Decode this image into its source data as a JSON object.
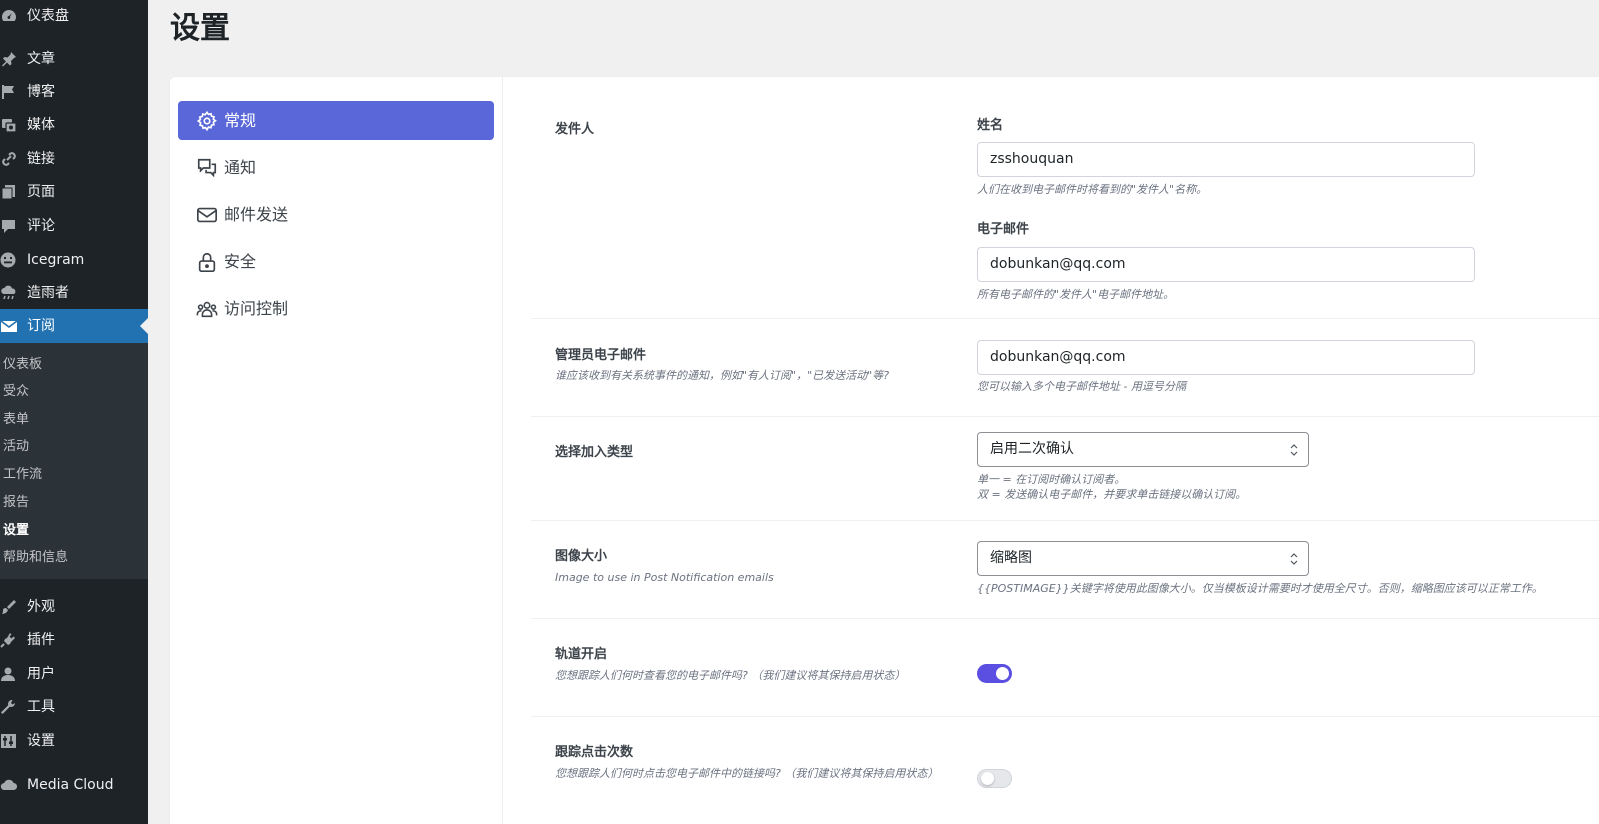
{
  "admin_menu": {
    "items": [
      {
        "label": "仪表盘",
        "icon": "dashboard-icon"
      },
      {
        "label": "文章",
        "icon": "pin-icon"
      },
      {
        "label": "博客",
        "icon": "flag-icon"
      },
      {
        "label": "媒体",
        "icon": "media-icon"
      },
      {
        "label": "链接",
        "icon": "link-icon"
      },
      {
        "label": "页面",
        "icon": "pages-icon"
      },
      {
        "label": "评论",
        "icon": "comment-icon"
      },
      {
        "label": "Icegram",
        "icon": "icegram-icon"
      },
      {
        "label": "造雨者",
        "icon": "cloud-rain-icon"
      },
      {
        "label": "订阅",
        "icon": "email-icon"
      },
      {
        "label": "外观",
        "icon": "brush-icon"
      },
      {
        "label": "插件",
        "icon": "plugin-icon"
      },
      {
        "label": "用户",
        "icon": "user-icon"
      },
      {
        "label": "工具",
        "icon": "wrench-icon"
      },
      {
        "label": "设置",
        "icon": "settings-icon"
      },
      {
        "label": "Media Cloud",
        "icon": "cloud-icon"
      }
    ],
    "submenu": [
      "仪表板",
      "受众",
      "表单",
      "活动",
      "工作流",
      "报告",
      "设置",
      "帮助和信息"
    ]
  },
  "page": {
    "title": "设置"
  },
  "tabs": [
    {
      "label": "常规",
      "icon": "gear-icon"
    },
    {
      "label": "通知",
      "icon": "chat-bubbles-icon"
    },
    {
      "label": "邮件发送",
      "icon": "envelope-icon"
    },
    {
      "label": "安全",
      "icon": "lock-icon"
    },
    {
      "label": "访问控制",
      "icon": "users-icon"
    }
  ],
  "settings": {
    "sender": {
      "title": "发件人",
      "name_label": "姓名",
      "name_value": "zsshouquan",
      "name_help": "人们在收到电子邮件时将看到的\"发件人\"名称。",
      "email_label": "电子邮件",
      "email_value": "dobunkan@qq.com",
      "email_help": "所有电子邮件的\"发件人\"电子邮件地址。"
    },
    "admin_email": {
      "title": "管理员电子邮件",
      "desc": "谁应该收到有关系统事件的通知，例如\"有人订阅\"，\"已发送活动\"等?",
      "value": "dobunkan@qq.com",
      "help": "您可以输入多个电子邮件地址 - 用逗号分隔"
    },
    "optin_type": {
      "title": "选择加入类型",
      "selected": "启用二次确认",
      "help_line1": "单一 = 在订阅时确认订阅者。",
      "help_line2": "双 = 发送确认电子邮件，并要求单击链接以确认订阅。"
    },
    "image_size": {
      "title": "图像大小",
      "desc": "Image to use in Post Notification emails",
      "selected": "缩略图",
      "help": "{{POSTIMAGE}}关键字将使用此图像大小。仅当模板设计需要时才使用全尺寸。否则，缩略图应该可以正常工作。"
    },
    "track_opens": {
      "title": "轨道开启",
      "desc": "您想跟踪人们何时查看您的电子邮件吗? （我们建议将其保持启用状态）",
      "enabled": true
    },
    "track_clicks": {
      "title": "跟踪点击次数",
      "desc": "您想跟踪人们何时点击您电子邮件中的链接吗? （我们建议将其保持启用状态）",
      "enabled": false
    }
  },
  "colors": {
    "accent": "#5a67d8",
    "toggle_on": "#5a4fe0",
    "menu_bg": "#1d2327",
    "menu_current": "#2271b1"
  }
}
